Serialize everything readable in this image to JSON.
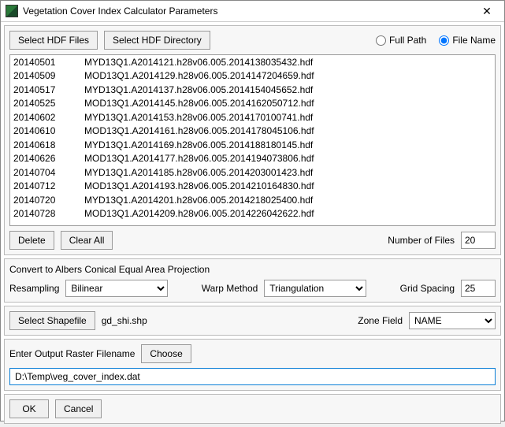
{
  "window": {
    "title": "Vegetation Cover Index Calculator Parameters",
    "close_glyph": "✕"
  },
  "files_panel": {
    "select_files_btn": "Select HDF Files",
    "select_dir_btn": "Select HDF Directory",
    "full_path_label": "Full Path",
    "file_name_label": "File Name",
    "path_mode": "file_name",
    "rows": [
      {
        "date": "20140501",
        "name": "MYD13Q1.A2014121.h28v06.005.2014138035432.hdf"
      },
      {
        "date": "20140509",
        "name": "MOD13Q1.A2014129.h28v06.005.2014147204659.hdf"
      },
      {
        "date": "20140517",
        "name": "MYD13Q1.A2014137.h28v06.005.2014154045652.hdf"
      },
      {
        "date": "20140525",
        "name": "MOD13Q1.A2014145.h28v06.005.2014162050712.hdf"
      },
      {
        "date": "20140602",
        "name": "MYD13Q1.A2014153.h28v06.005.2014170100741.hdf"
      },
      {
        "date": "20140610",
        "name": "MOD13Q1.A2014161.h28v06.005.2014178045106.hdf"
      },
      {
        "date": "20140618",
        "name": "MYD13Q1.A2014169.h28v06.005.2014188180145.hdf"
      },
      {
        "date": "20140626",
        "name": "MOD13Q1.A2014177.h28v06.005.2014194073806.hdf"
      },
      {
        "date": "20140704",
        "name": "MYD13Q1.A2014185.h28v06.005.2014203001423.hdf"
      },
      {
        "date": "20140712",
        "name": "MOD13Q1.A2014193.h28v06.005.2014210164830.hdf"
      },
      {
        "date": "20140720",
        "name": "MYD13Q1.A2014201.h28v06.005.2014218025400.hdf"
      },
      {
        "date": "20140728",
        "name": "MOD13Q1.A2014209.h28v06.005.2014226042622.hdf"
      }
    ],
    "delete_btn": "Delete",
    "clear_btn": "Clear All",
    "num_files_label": "Number of Files",
    "num_files_value": "20"
  },
  "projection_panel": {
    "title": "Convert to Albers Conical Equal Area Projection",
    "resampling_label": "Resampling",
    "resampling_value": "Bilinear",
    "warp_label": "Warp Method",
    "warp_value": "Triangulation",
    "grid_label": "Grid Spacing",
    "grid_value": "25"
  },
  "shapefile_panel": {
    "select_btn": "Select Shapefile",
    "shapefile_name": "gd_shi.shp",
    "zone_label": "Zone Field",
    "zone_value": "NAME"
  },
  "output_panel": {
    "label": "Enter Output Raster Filename",
    "choose_btn": "Choose",
    "path_value": "D:\\Temp\\veg_cover_index.dat"
  },
  "actions": {
    "ok": "OK",
    "cancel": "Cancel"
  }
}
